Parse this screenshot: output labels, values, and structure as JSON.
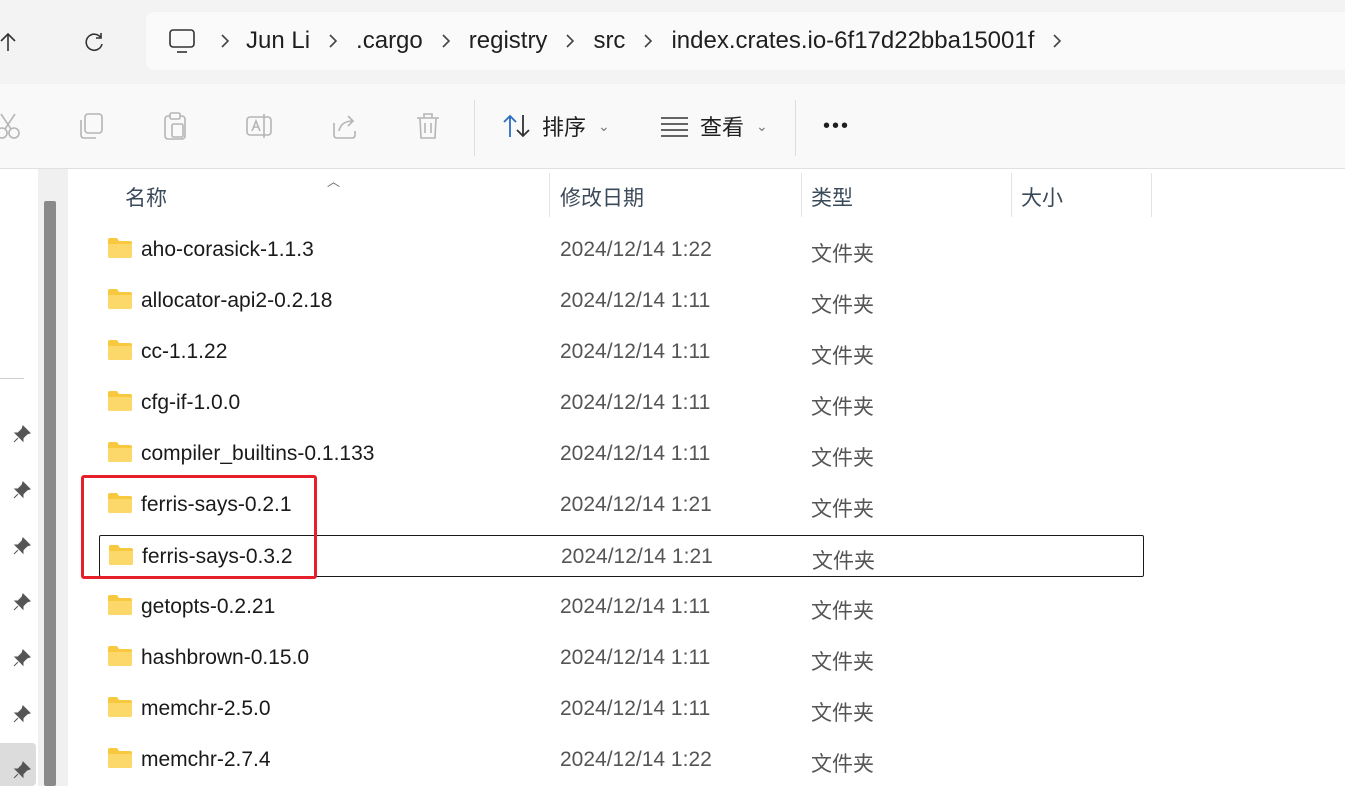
{
  "address_bar": {
    "crumbs": [
      "Jun Li",
      ".cargo",
      "registry",
      "src",
      "index.crates.io-6f17d22bba15001f"
    ]
  },
  "command_bar": {
    "sort_label": "排序",
    "view_label": "查看",
    "more_label": "•••"
  },
  "columns": {
    "name": "名称",
    "date": "修改日期",
    "type": "类型",
    "size": "大小"
  },
  "files": [
    {
      "name": "aho-corasick-1.1.3",
      "date": "2024/12/14 1:22",
      "type": "文件夹"
    },
    {
      "name": "allocator-api2-0.2.18",
      "date": "2024/12/14 1:11",
      "type": "文件夹"
    },
    {
      "name": "cc-1.1.22",
      "date": "2024/12/14 1:11",
      "type": "文件夹"
    },
    {
      "name": "cfg-if-1.0.0",
      "date": "2024/12/14 1:11",
      "type": "文件夹"
    },
    {
      "name": "compiler_builtins-0.1.133",
      "date": "2024/12/14 1:11",
      "type": "文件夹"
    },
    {
      "name": "ferris-says-0.2.1",
      "date": "2024/12/14 1:21",
      "type": "文件夹"
    },
    {
      "name": "ferris-says-0.3.2",
      "date": "2024/12/14 1:21",
      "type": "文件夹"
    },
    {
      "name": "getopts-0.2.21",
      "date": "2024/12/14 1:11",
      "type": "文件夹"
    },
    {
      "name": "hashbrown-0.15.0",
      "date": "2024/12/14 1:11",
      "type": "文件夹"
    },
    {
      "name": "memchr-2.5.0",
      "date": "2024/12/14 1:11",
      "type": "文件夹"
    },
    {
      "name": "memchr-2.7.4",
      "date": "2024/12/14 1:22",
      "type": "文件夹"
    }
  ],
  "colors": {
    "highlight": "#e5202a",
    "folder": "#f8c93e"
  }
}
